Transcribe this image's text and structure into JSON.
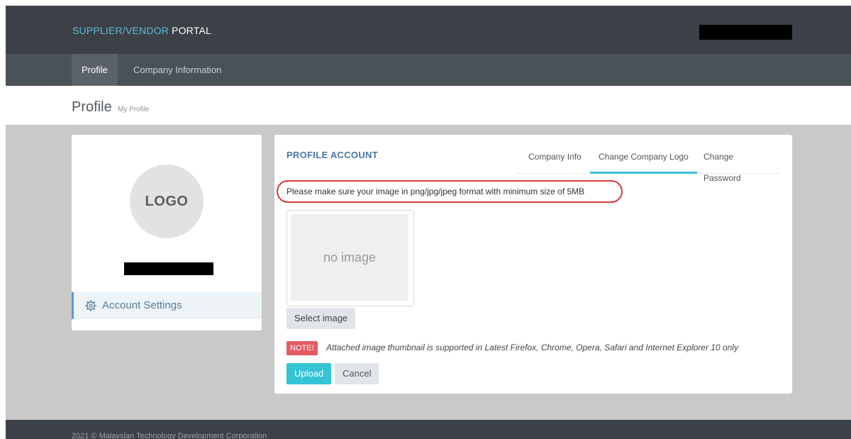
{
  "header": {
    "brand_part1": "SUPPLIER/VENDOR",
    "brand_part2": "PORTAL"
  },
  "nav": {
    "items": [
      {
        "label": "Profile",
        "active": true
      },
      {
        "label": "Company Information",
        "active": false
      }
    ]
  },
  "page": {
    "title": "Profile",
    "subtitle": "My Profile"
  },
  "sidebar": {
    "logo_text": "LOGO",
    "account_settings_label": "Account Settings"
  },
  "main": {
    "title": "PROFILE ACCOUNT",
    "tabs": [
      {
        "label": "Company Info",
        "active": false
      },
      {
        "label": "Change Company Logo",
        "active": true
      },
      {
        "label": "Change Password",
        "active": false
      }
    ],
    "notice": "Please make sure your image in png/jpg/jpeg format with minimum size of 5MB",
    "thumbnail_placeholder": "no image",
    "select_image_label": "Select image",
    "note_badge": "NOTE!",
    "note_text": "Attached image thumbnail is supported in Latest Firefox, Chrome, Opera, Safari and Internet Explorer 10 only",
    "upload_label": "Upload",
    "cancel_label": "Cancel"
  },
  "footer": {
    "text": "2021 © Malaysian Technology Development Corporation"
  },
  "colors": {
    "header_bg": "#3b4147",
    "nav_bg": "#4a5157",
    "accent": "#34c3d7",
    "note_red": "#e25b63",
    "highlight_outline": "#d9363e"
  }
}
